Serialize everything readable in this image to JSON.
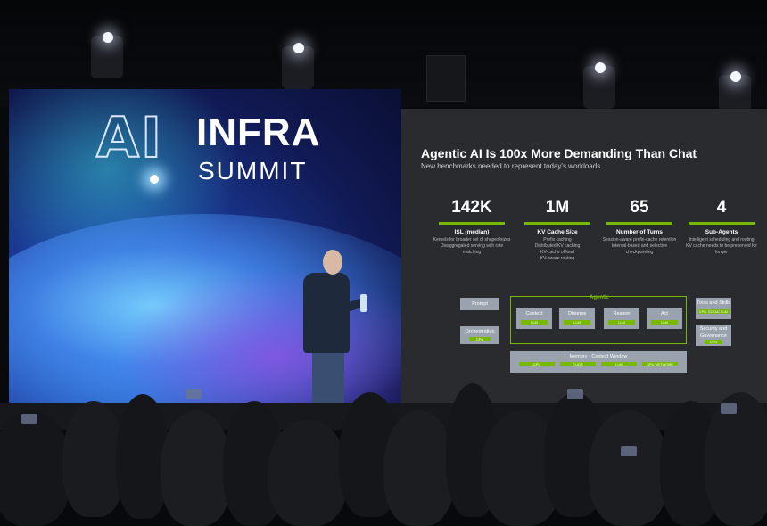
{
  "left_screen": {
    "logo_ai": "AI",
    "logo_infra": "INFRA",
    "logo_summit": "SUMMIT"
  },
  "slide": {
    "title": "Agentic AI Is 100x More Demanding Than Chat",
    "subtitle": "New benchmarks needed to represent today's workloads",
    "stats": [
      {
        "value": "142K",
        "label": "ISL (median)",
        "desc1": "Kernels for broader set of shapes/sizes",
        "desc2": "Disaggregated serving with rate matching"
      },
      {
        "value": "1M",
        "label": "KV Cache Size",
        "desc1": "Prefix caching",
        "desc2": "Distributed KV caching",
        "desc3": "KV-cache offload",
        "desc4": "KV-aware routing"
      },
      {
        "value": "65",
        "label": "Number of Turns",
        "desc1": "Session-aware prefix-cache retention",
        "desc2": "Interval-based and selective checkpointing"
      },
      {
        "value": "4",
        "label": "Sub-Agents",
        "desc1": "Intelligent scheduling and routing",
        "desc2": "KV cache needs to be preserved for longer"
      }
    ],
    "diagram": {
      "agentic_label": "Agentic",
      "prompt": "Prompt",
      "orchestration": "Orchestration",
      "orchestration_tag": "CPU",
      "steps": [
        "Context",
        "Observe",
        "Reason",
        "Act"
      ],
      "step_tag": "LLM",
      "tools": "Tools and Skills",
      "tools_tags": [
        "CPU",
        "CUDA",
        "LLM"
      ],
      "security": "Security and Governance",
      "security_tag": "CPU",
      "memory": "Memory · Context Window",
      "memory_tags": [
        "GPU",
        "CUDA",
        "LLM",
        "GPU NETWORK"
      ]
    }
  }
}
